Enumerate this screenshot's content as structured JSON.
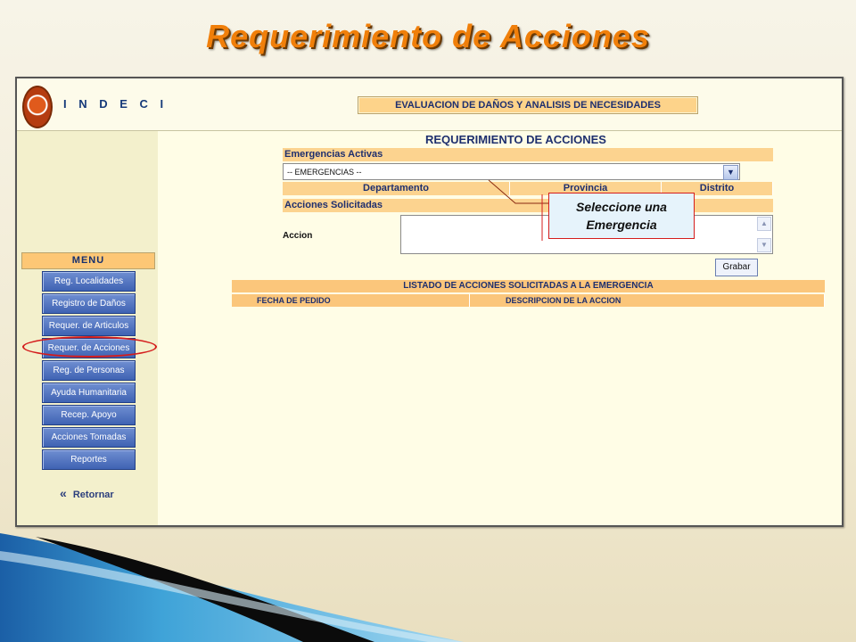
{
  "slide": {
    "title": "Requerimiento de Acciones"
  },
  "header": {
    "brand": "I N D E C I",
    "system_title": "EVALUACION DE DAÑOS Y ANALISIS DE NECESIDADES"
  },
  "sidebar": {
    "menu_label": "MENU",
    "items": [
      {
        "label": "Reg. Localidades"
      },
      {
        "label": "Registro de Daños"
      },
      {
        "label": "Requer. de Articulos"
      },
      {
        "label": "Requer. de Acciones"
      },
      {
        "label": "Reg. de Personas"
      },
      {
        "label": "Ayuda Humanitaria"
      },
      {
        "label": "Recep. Apoyo"
      },
      {
        "label": "Acciones Tomadas"
      },
      {
        "label": "Reportes"
      }
    ],
    "back_label": "Retornar"
  },
  "form": {
    "title": "REQUERIMIENTO DE ACCIONES",
    "emergencias_label": "Emergencias Activas",
    "emergencia_selected": "-- EMERGENCIAS --",
    "geo_columns": [
      "Departamento",
      "Provincia",
      "Distrito"
    ],
    "acciones_label": "Acciones Solicitadas",
    "accion_field_label": "Accion",
    "accion_value": "",
    "save_label": "Grabar"
  },
  "listing": {
    "title": "LISTADO DE ACCIONES SOLICITADAS A LA EMERGENCIA",
    "columns": [
      "FECHA DE PEDIDO",
      "DESCRIPCION DE LA ACCION"
    ]
  },
  "callout": {
    "text": "Seleccione una Emergencia"
  },
  "colors": {
    "title_orange": "#f07f0a",
    "menu_blue": "#3f63b3",
    "header_tan": "#fcd38f",
    "highlight_red": "#d41c1c"
  },
  "icons": {
    "back": "double-chevron-left-icon",
    "dropdown": "chevron-down-icon"
  }
}
